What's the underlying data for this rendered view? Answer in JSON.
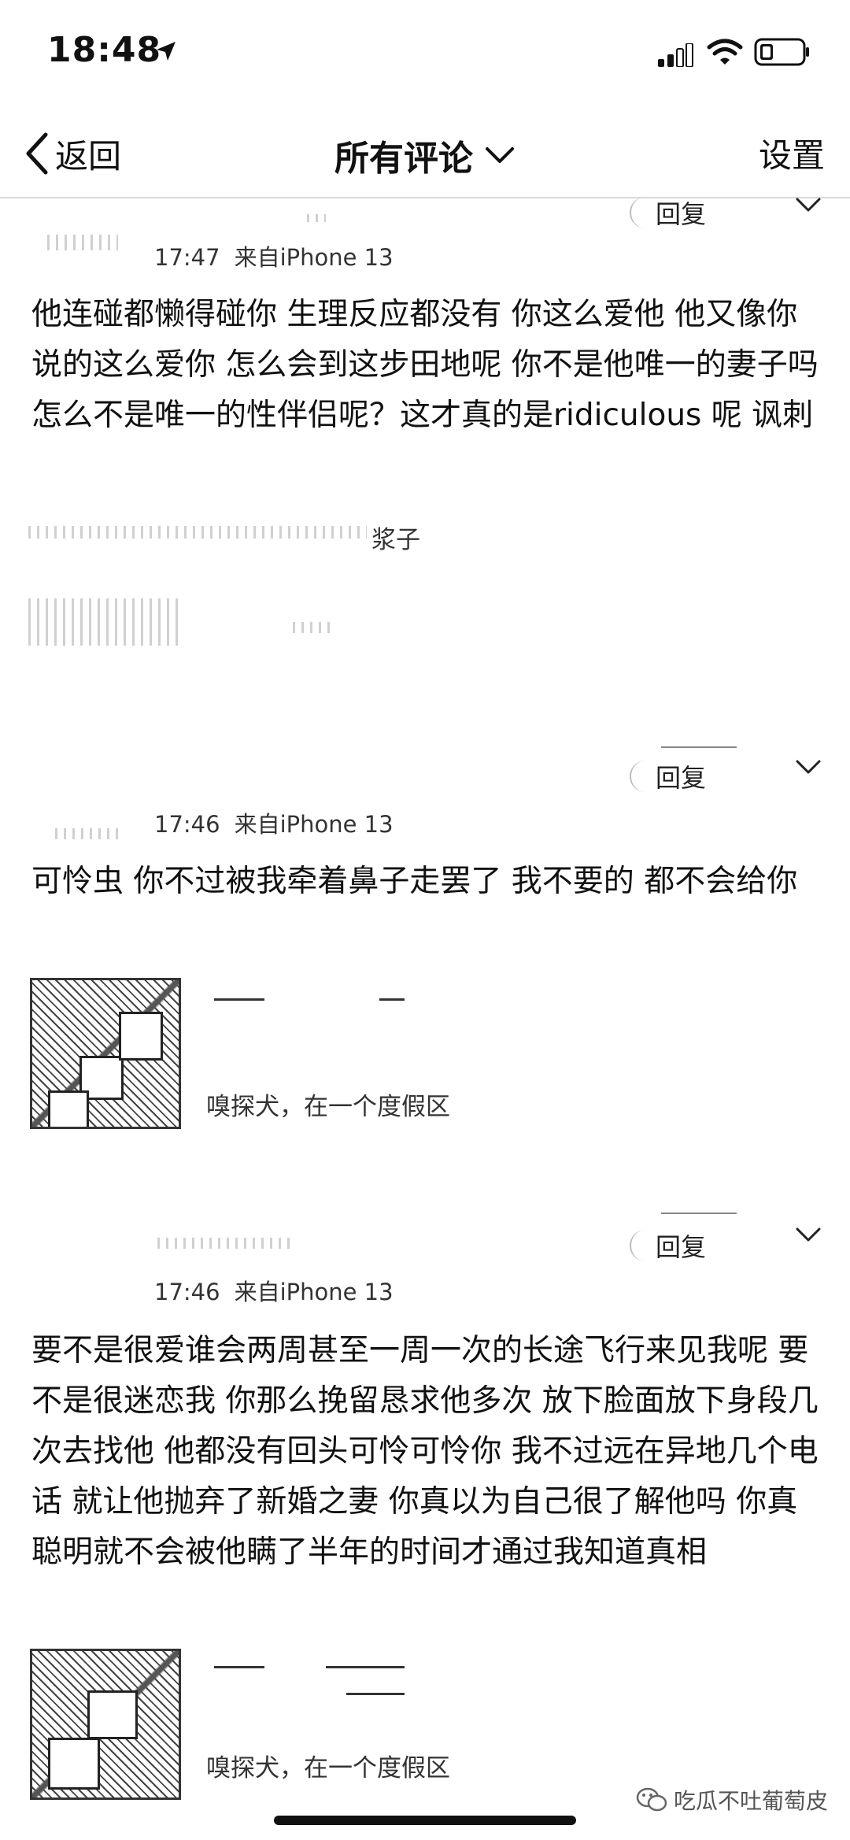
{
  "status_bar": {
    "time": "18:48"
  },
  "nav": {
    "back_label": "返回",
    "title": "所有评论",
    "settings_label": "设置"
  },
  "comments": [
    {
      "reply_label": "回复",
      "time": "17:47",
      "source": "来自iPhone 13",
      "text": "他连碰都懒得碰你 生理反应都没有 你这么爱他 他又像你说的这么爱你 怎么会到这步田地呢 你不是他唯一的妻子吗 怎么不是唯一的性伴侣呢？这才真的是ridiculous 呢 讽刺",
      "quote_text": "浆子"
    },
    {
      "reply_label": "回复",
      "time": "17:46",
      "source": "来自iPhone 13",
      "text": "可怜虫 你不过被我牵着鼻子走罢了 我不要的 都不会给你",
      "quote_text": "嗅探犬，在一个度假区"
    },
    {
      "reply_label": "回复",
      "time": "17:46",
      "source": "来自iPhone 13",
      "text": "要不是很爱谁会两周甚至一周一次的长途飞行来见我呢 要不是很迷恋我 你那么挽留恳求他多次 放下脸面放下身段几次去找他 他都没有回头可怜可怜你 我不过远在异地几个电话 就让他抛弃了新婚之妻 你真以为自己很了解他吗 你真聪明就不会被他瞒了半年的时间才通过我知道真相",
      "quote_text": "嗅探犬，在一个度假区"
    }
  ],
  "watermark": {
    "text": "吃瓜不吐葡萄皮"
  }
}
